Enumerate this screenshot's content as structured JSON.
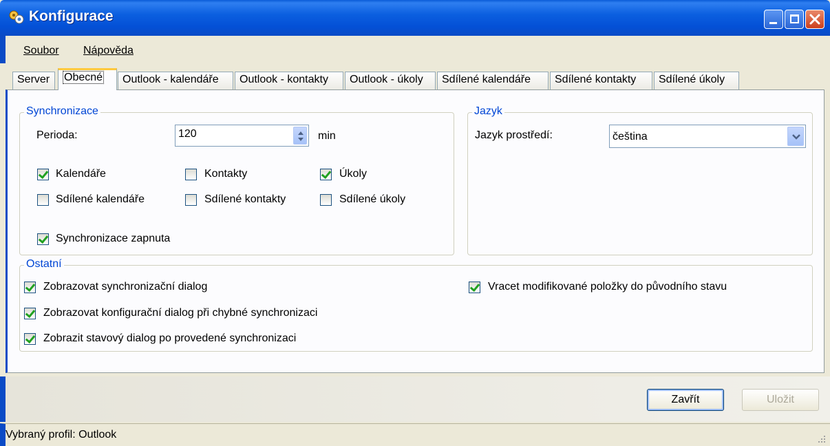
{
  "window": {
    "title": "Konfigurace"
  },
  "menu": [
    "Soubor",
    "Nápověda"
  ],
  "tabs": [
    "Server",
    "Obecné",
    "Outlook - kalendáře",
    "Outlook - kontakty",
    "Outlook - úkoly",
    "Sdílené kalendáře",
    "Sdílené kontakty",
    "Sdílené úkoly"
  ],
  "active_tab": "Obecné",
  "sync_group": {
    "title": "Synchronizace",
    "period_label": "Perioda:",
    "period_value": "120",
    "period_unit": "min",
    "checkboxes": [
      {
        "label": "Kalendáře",
        "checked": true
      },
      {
        "label": "Kontakty",
        "checked": false
      },
      {
        "label": "Úkoly",
        "checked": true
      },
      {
        "label": "Sdílené kalendáře",
        "checked": false
      },
      {
        "label": "Sdílené kontakty",
        "checked": false
      },
      {
        "label": "Sdílené úkoly",
        "checked": false
      },
      {
        "label": "Synchronizace zapnuta",
        "checked": true
      }
    ]
  },
  "lang_group": {
    "title": "Jazyk",
    "label": "Jazyk prostředí:",
    "value": "čeština"
  },
  "other_group": {
    "title": "Ostatní",
    "checkboxes": [
      {
        "label": "Zobrazovat synchronizační dialog",
        "checked": true
      },
      {
        "label": "Zobrazovat konfigurační dialog při chybné synchronizaci",
        "checked": true
      },
      {
        "label": "Zobrazit stavový dialog po provedené synchronizaci",
        "checked": true
      },
      {
        "label": "Vracet modifikované položky do původního stavu",
        "checked": true
      }
    ]
  },
  "buttons": {
    "close": "Zavřít",
    "save": "Uložit"
  },
  "status": "Vybraný profil: Outlook",
  "colors": {
    "titlebar": "#0a5bd8",
    "group_title": "#0046d5",
    "check": "#21a121",
    "tab_highlight": "#ffc83c"
  }
}
